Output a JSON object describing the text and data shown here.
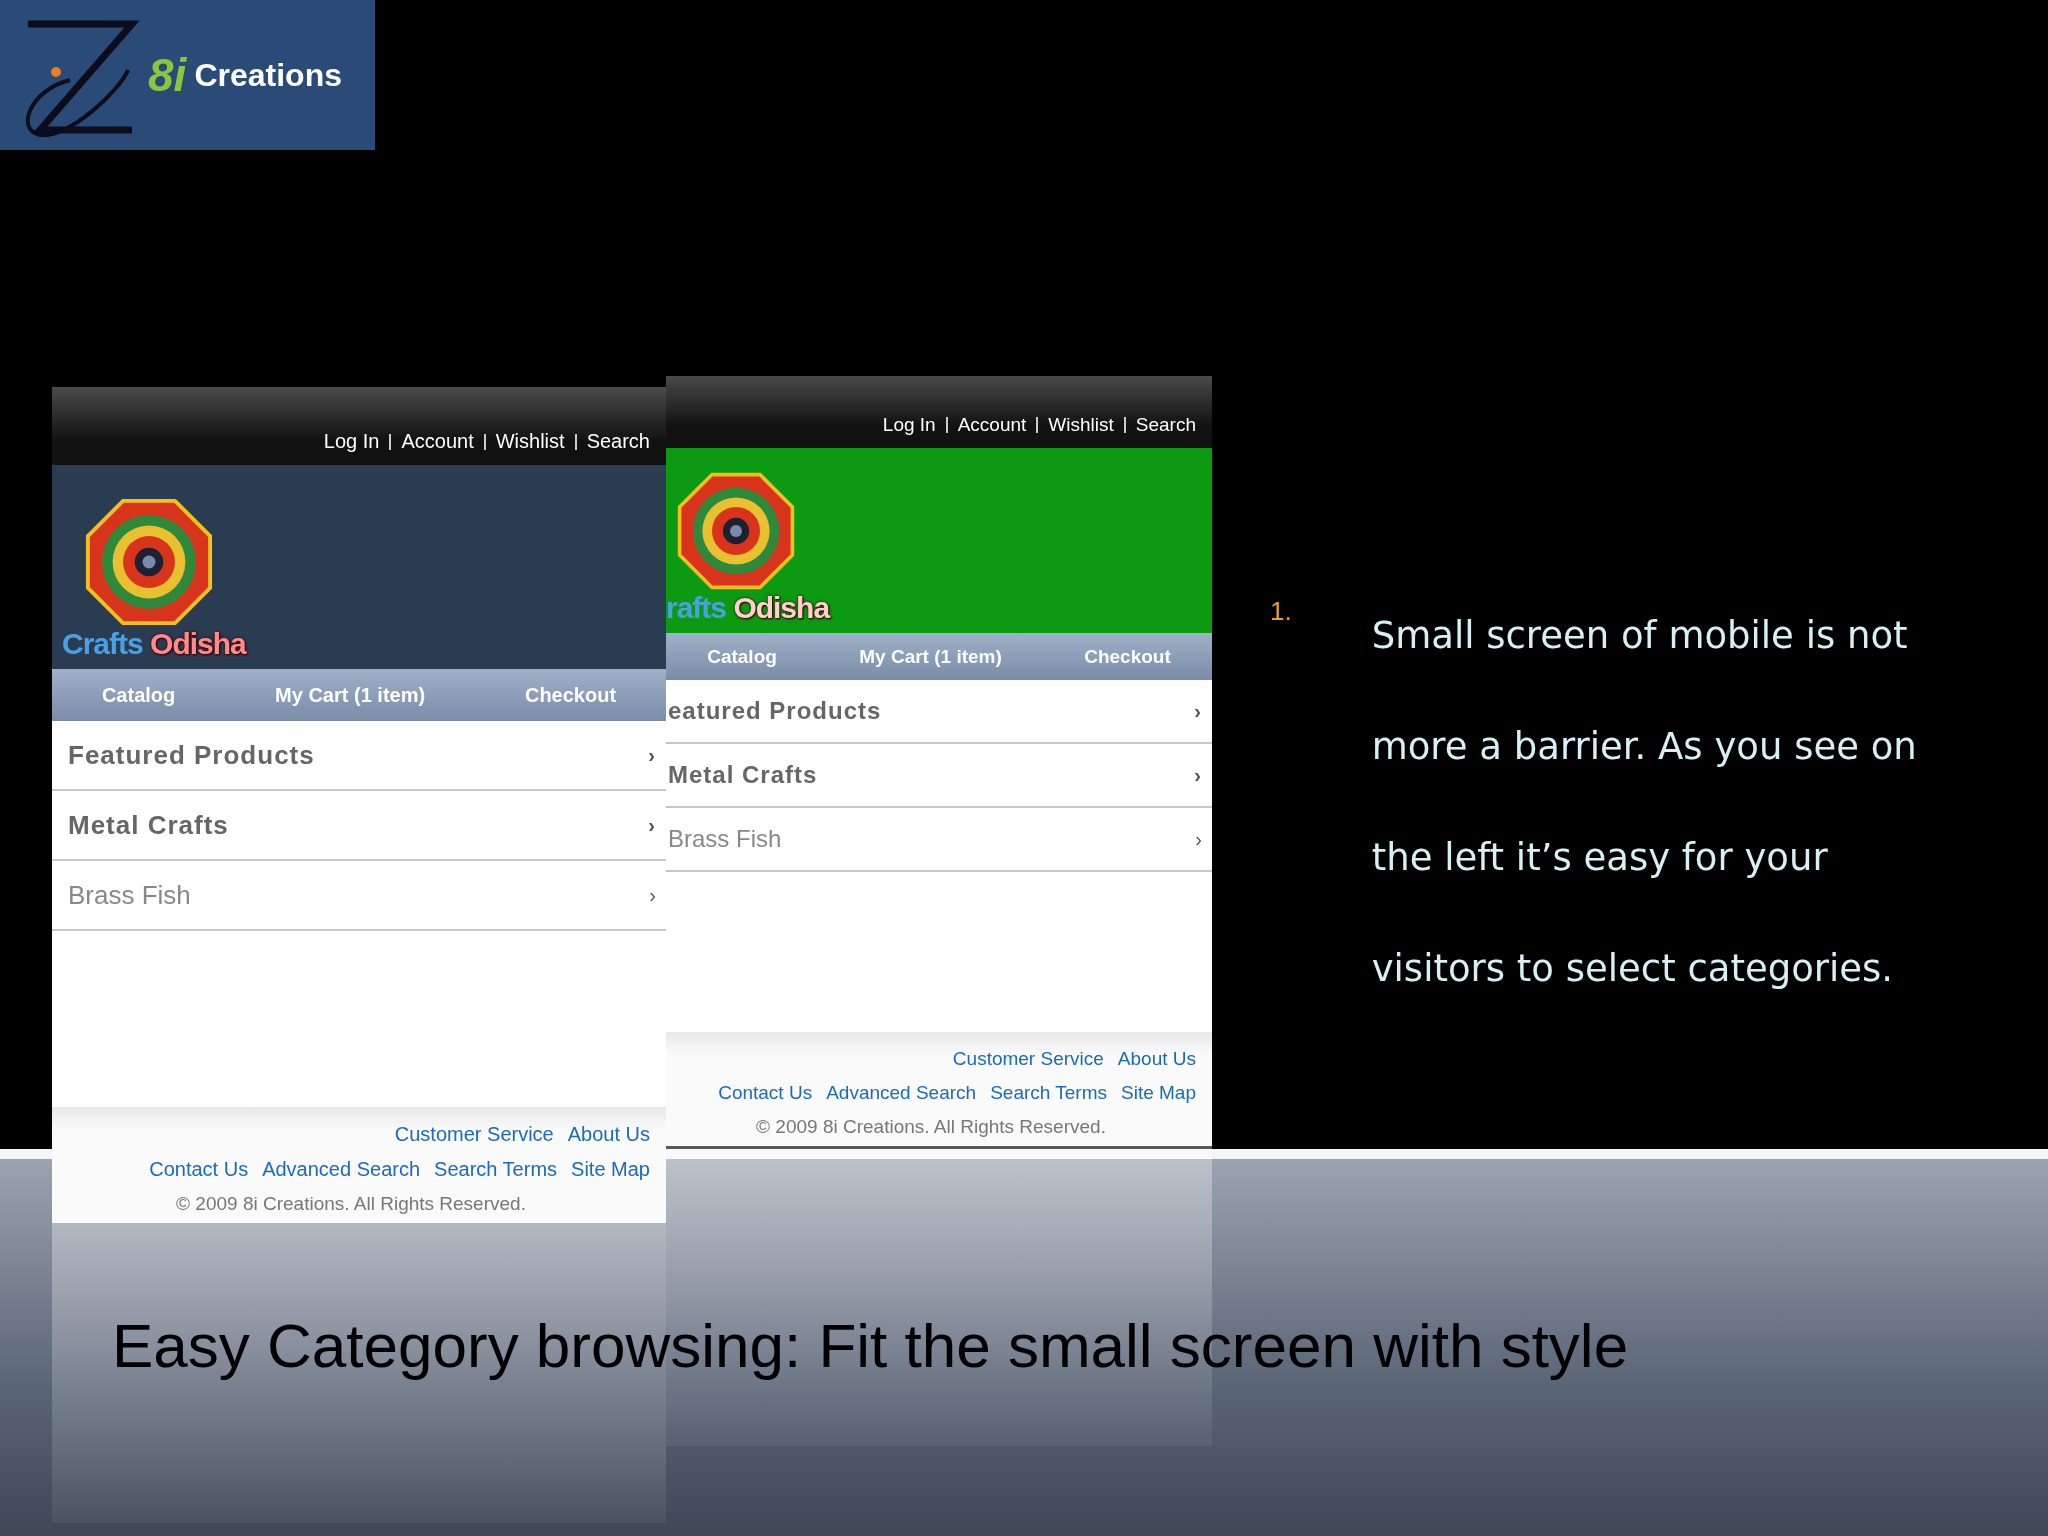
{
  "logo": {
    "mark": "8i",
    "name": "Creations"
  },
  "phones": [
    {
      "top_links": [
        "Log In",
        "Account",
        "Wishlist",
        "Search"
      ],
      "color": "#2a3c52",
      "brand": {
        "first": "Crafts",
        "second": "Odisha"
      },
      "nav": [
        "Catalog",
        "My Cart (1 item)",
        "Checkout"
      ],
      "rows": [
        {
          "label": "Featured Products",
          "kind": "heading",
          "arrow": "›"
        },
        {
          "label": "Metal Crafts",
          "kind": "heading",
          "arrow": "›"
        },
        {
          "label": "Brass Fish",
          "kind": "item",
          "arrow": "›"
        }
      ],
      "footer_links": [
        [
          "Customer Service",
          "About Us"
        ],
        [
          "Contact Us",
          "Advanced Search",
          "Search Terms",
          "Site Map"
        ]
      ],
      "copyright": "© 2009 8i Creations. All Rights Reserved."
    },
    {
      "top_links": [
        "Log In",
        "Account",
        "Wishlist",
        "Search"
      ],
      "color": "#0b9a12",
      "brand": {
        "first": "rafts",
        "second": "Odisha"
      },
      "nav": [
        "Catalog",
        "My Cart (1 item)",
        "Checkout"
      ],
      "rows": [
        {
          "label": "eatured Products",
          "kind": "heading",
          "arrow": "›"
        },
        {
          "label": "Metal Crafts",
          "kind": "heading",
          "arrow": "›"
        },
        {
          "label": "Brass Fish",
          "kind": "item",
          "arrow": "›"
        }
      ],
      "footer_links": [
        [
          "Customer Service",
          "About Us"
        ],
        [
          "Contact Us",
          "Advanced Search",
          "Search Terms",
          "Site Map"
        ]
      ],
      "copyright": "© 2009 8i Creations. All Rights Reserved."
    }
  ],
  "bullet": {
    "number": "1.",
    "text": "Small screen of mobile is not more a barrier. As you see on the left it’s easy for your visitors to select categories."
  },
  "title": "Easy Category browsing: Fit the small screen with style"
}
